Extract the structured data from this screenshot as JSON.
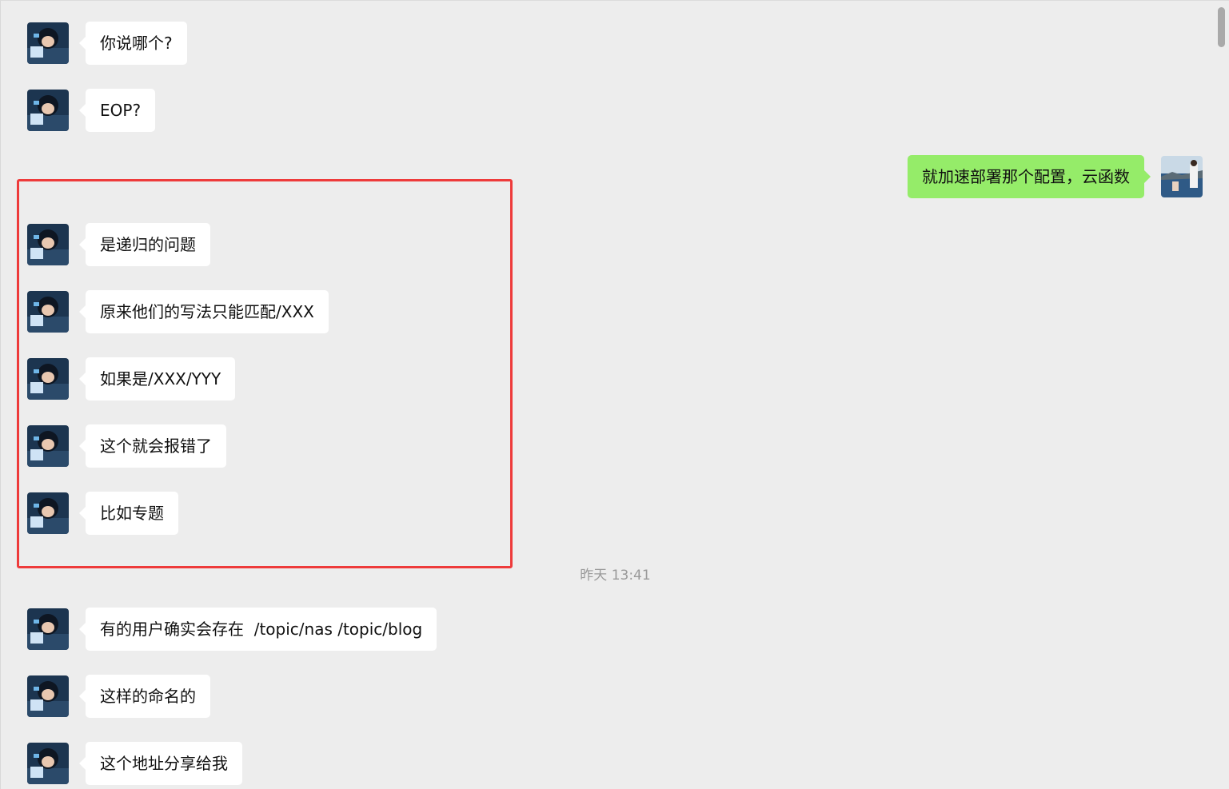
{
  "chat": {
    "messages": [
      {
        "side": "left",
        "text": "你说哪个?"
      },
      {
        "side": "left",
        "text": "EOP?"
      },
      {
        "side": "right",
        "text": "就加速部署那个配置，云函数"
      },
      {
        "side": "left",
        "text": "是递归的问题"
      },
      {
        "side": "left",
        "text": "原来他们的写法只能匹配/XXX"
      },
      {
        "side": "left",
        "text": "如果是/XXX/YYY"
      },
      {
        "side": "left",
        "text": "这个就会报错了"
      },
      {
        "side": "left",
        "text": "比如专题"
      },
      {
        "side": "left",
        "text": "有的用户确实会存在  /topic/nas /topic/blog"
      },
      {
        "side": "left",
        "text": "这样的命名的"
      },
      {
        "side": "left",
        "text": "这个地址分享给我"
      }
    ],
    "timestamp": "昨天 13:41"
  },
  "colors": {
    "background": "#ededed",
    "incoming_bubble": "#ffffff",
    "outgoing_bubble": "#95ec69",
    "highlight_border": "#ee3b3b",
    "timestamp_text": "#9a9a9a"
  },
  "icons": {
    "contact_avatar": "anime-avatar-icon",
    "self_avatar": "seaside-photo-avatar-icon"
  }
}
